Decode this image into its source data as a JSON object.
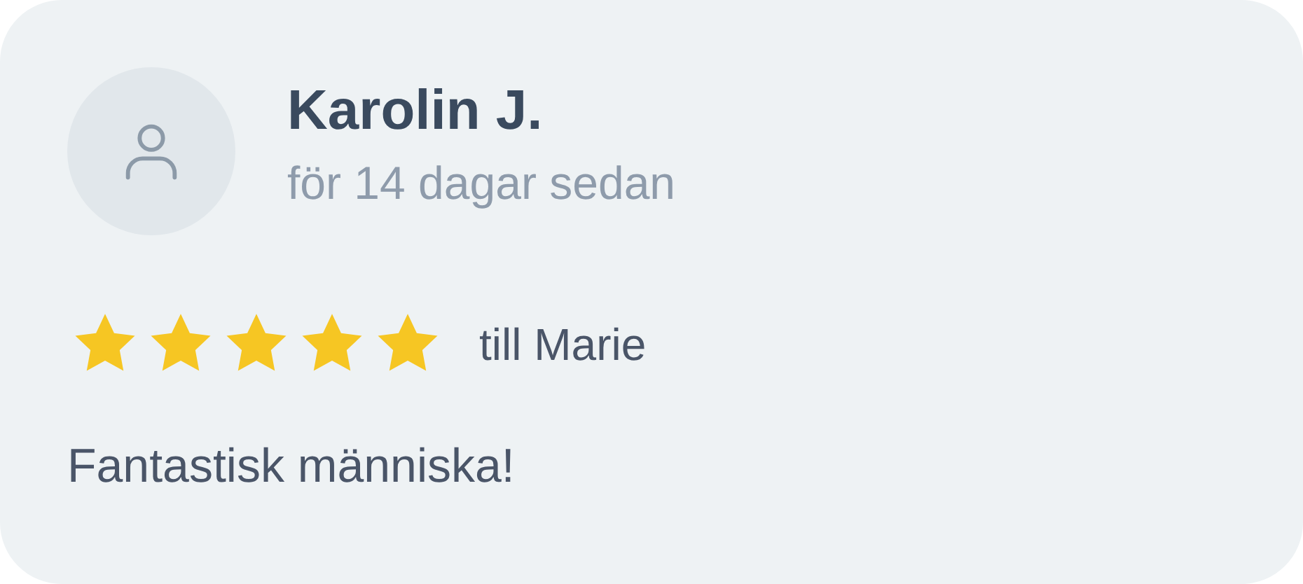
{
  "review": {
    "author": "Karolin J.",
    "time": "för 14 dagar sedan",
    "stars": 5,
    "recipient": "till Marie",
    "text": "Fantastisk människa!"
  }
}
